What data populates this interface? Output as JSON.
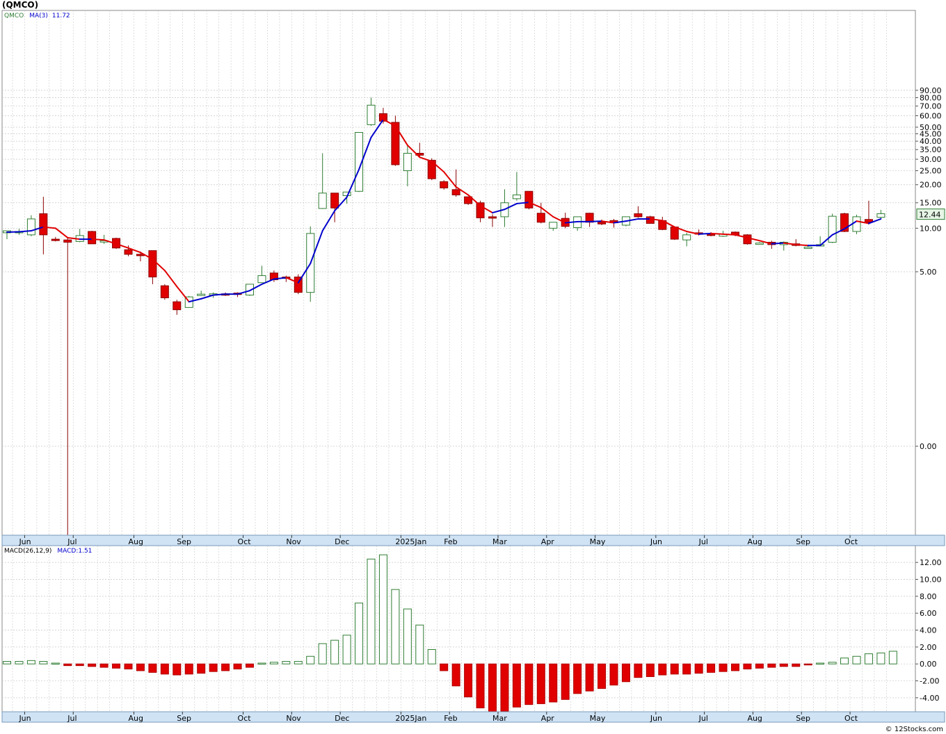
{
  "ticker_label": "(QMCO)",
  "credit": "© 12Stocks.com",
  "colors": {
    "up": "#2e7d32",
    "down": "#e00000",
    "ma_up": "#0000cc",
    "ma_down": "#e00000",
    "grid": "#c8c8c8",
    "axis_band": "#cfe3f5"
  },
  "chart_data": [
    {
      "type": "candlestick",
      "title": "",
      "legend": {
        "series_label": "QMCO",
        "ma_label": "MA(3)",
        "ma_value": "11.72"
      },
      "price_scale": "log",
      "y_ticks": [
        "90.00",
        "80.00",
        "70.00",
        "60.00",
        "50.00",
        "45.00",
        "40.00",
        "35.00",
        "30.00",
        "25.00",
        "20.00",
        "15.00",
        "10.00",
        "5.00",
        "0.00"
      ],
      "last_price": "12.44",
      "x_month_labels": [
        "Jun",
        "Jul",
        "Aug",
        "Sep",
        "Oct",
        "Nov",
        "Dec",
        "2025Jan",
        "Feb",
        "Mar",
        "Apr",
        "May",
        "Jun",
        "Jul",
        "Aug",
        "Sep",
        "Oct"
      ],
      "candles": [
        {
          "o": 9.3,
          "h": 9.6,
          "l": 8.4,
          "c": 9.6
        },
        {
          "o": 9.3,
          "h": 9.9,
          "l": 9.0,
          "c": 9.5
        },
        {
          "o": 9.0,
          "h": 12.3,
          "l": 8.8,
          "c": 11.6
        },
        {
          "o": 12.6,
          "h": 16.5,
          "l": 6.6,
          "c": 9.0
        },
        {
          "o": 8.4,
          "h": 8.7,
          "l": 8.1,
          "c": 8.3
        },
        {
          "o": 8.3,
          "h": 8.6,
          "l": 0.1,
          "c": 8.0
        },
        {
          "o": 8.1,
          "h": 9.9,
          "l": 8.0,
          "c": 8.9
        },
        {
          "o": 9.5,
          "h": 9.6,
          "l": 7.8,
          "c": 7.8
        },
        {
          "o": 8.1,
          "h": 9.0,
          "l": 7.8,
          "c": 8.2
        },
        {
          "o": 8.5,
          "h": 8.6,
          "l": 7.2,
          "c": 7.3
        },
        {
          "o": 7.1,
          "h": 7.6,
          "l": 6.4,
          "c": 6.6
        },
        {
          "o": 6.6,
          "h": 6.9,
          "l": 5.9,
          "c": 6.5
        },
        {
          "o": 7.0,
          "h": 7.0,
          "l": 4.1,
          "c": 4.6
        },
        {
          "o": 4.0,
          "h": 4.1,
          "l": 3.2,
          "c": 3.3
        },
        {
          "o": 3.1,
          "h": 3.2,
          "l": 2.52,
          "c": 2.73
        },
        {
          "o": 2.83,
          "h": 3.4,
          "l": 2.82,
          "c": 3.35
        },
        {
          "o": 3.47,
          "h": 3.7,
          "l": 3.4,
          "c": 3.5
        },
        {
          "o": 3.5,
          "h": 3.6,
          "l": 3.3,
          "c": 3.52
        },
        {
          "o": 3.52,
          "h": 3.6,
          "l": 3.4,
          "c": 3.5
        },
        {
          "o": 3.56,
          "h": 3.6,
          "l": 3.34,
          "c": 3.48
        },
        {
          "o": 3.45,
          "h": 4.1,
          "l": 3.4,
          "c": 4.1
        },
        {
          "o": 4.2,
          "h": 5.5,
          "l": 4.2,
          "c": 4.7
        },
        {
          "o": 4.9,
          "h": 5.1,
          "l": 4.25,
          "c": 4.4
        },
        {
          "o": 4.6,
          "h": 4.7,
          "l": 4.25,
          "c": 4.55
        },
        {
          "o": 4.6,
          "h": 4.8,
          "l": 3.5,
          "c": 3.6
        },
        {
          "o": 3.6,
          "h": 10.3,
          "l": 3.1,
          "c": 9.2
        },
        {
          "o": 13.7,
          "h": 33.0,
          "l": 13.6,
          "c": 17.5
        },
        {
          "o": 17.5,
          "h": 17.5,
          "l": 11.0,
          "c": 13.8
        },
        {
          "o": 16.8,
          "h": 17.7,
          "l": 14.8,
          "c": 17.8
        },
        {
          "o": 18.0,
          "h": 45.5,
          "l": 17.8,
          "c": 46.0
        },
        {
          "o": 52.0,
          "h": 80.0,
          "l": 51.0,
          "c": 71.0
        },
        {
          "o": 62.0,
          "h": 68.0,
          "l": 53.0,
          "c": 55.0
        },
        {
          "o": 54.0,
          "h": 60.0,
          "l": 27.0,
          "c": 27.5
        },
        {
          "o": 25.0,
          "h": 38.0,
          "l": 19.5,
          "c": 33.0
        },
        {
          "o": 33.0,
          "h": 39.0,
          "l": 31.0,
          "c": 32.0
        },
        {
          "o": 29.5,
          "h": 30.5,
          "l": 21.5,
          "c": 22.0
        },
        {
          "o": 21.0,
          "h": 21.5,
          "l": 18.5,
          "c": 19.0
        },
        {
          "o": 18.5,
          "h": 25.5,
          "l": 16.5,
          "c": 17.0
        },
        {
          "o": 16.5,
          "h": 16.5,
          "l": 14.5,
          "c": 14.8
        },
        {
          "o": 15.0,
          "h": 15.5,
          "l": 11.0,
          "c": 11.8
        },
        {
          "o": 12.0,
          "h": 12.5,
          "l": 10.2,
          "c": 11.8
        },
        {
          "o": 12.0,
          "h": 18.6,
          "l": 10.2,
          "c": 15.0
        },
        {
          "o": 16.0,
          "h": 24.5,
          "l": 15.5,
          "c": 17.0
        },
        {
          "o": 18.0,
          "h": 18.0,
          "l": 13.5,
          "c": 13.8
        },
        {
          "o": 12.7,
          "h": 15.0,
          "l": 10.8,
          "c": 11.0
        },
        {
          "o": 10.0,
          "h": 11.0,
          "l": 9.6,
          "c": 11.0
        },
        {
          "o": 11.7,
          "h": 12.8,
          "l": 10.0,
          "c": 10.3
        },
        {
          "o": 10.1,
          "h": 11.8,
          "l": 9.6,
          "c": 12.0
        },
        {
          "o": 12.7,
          "h": 12.8,
          "l": 10.2,
          "c": 11.0
        },
        {
          "o": 11.0,
          "h": 11.5,
          "l": 10.5,
          "c": 10.7
        },
        {
          "o": 11.3,
          "h": 11.6,
          "l": 10.1,
          "c": 10.9
        },
        {
          "o": 10.5,
          "h": 12.0,
          "l": 10.3,
          "c": 12.0
        },
        {
          "o": 12.6,
          "h": 14.2,
          "l": 11.8,
          "c": 12.0
        },
        {
          "o": 12.0,
          "h": 12.2,
          "l": 10.8,
          "c": 10.8
        },
        {
          "o": 11.3,
          "h": 12.0,
          "l": 9.7,
          "c": 9.8
        },
        {
          "o": 10.2,
          "h": 10.2,
          "l": 8.3,
          "c": 8.4
        },
        {
          "o": 8.3,
          "h": 9.3,
          "l": 7.5,
          "c": 9.0
        },
        {
          "o": 9.3,
          "h": 9.8,
          "l": 8.9,
          "c": 9.2
        },
        {
          "o": 9.1,
          "h": 9.4,
          "l": 8.8,
          "c": 8.9
        },
        {
          "o": 8.8,
          "h": 9.6,
          "l": 8.7,
          "c": 9.1
        },
        {
          "o": 9.4,
          "h": 9.5,
          "l": 8.8,
          "c": 9.0
        },
        {
          "o": 9.0,
          "h": 9.1,
          "l": 7.7,
          "c": 7.8
        },
        {
          "o": 7.8,
          "h": 8.0,
          "l": 7.7,
          "c": 7.9
        },
        {
          "o": 8.0,
          "h": 8.2,
          "l": 7.2,
          "c": 7.7
        },
        {
          "o": 7.7,
          "h": 8.1,
          "l": 7.0,
          "c": 8.0
        },
        {
          "o": 7.8,
          "h": 8.4,
          "l": 7.5,
          "c": 7.6
        },
        {
          "o": 7.3,
          "h": 7.6,
          "l": 7.2,
          "c": 7.4
        },
        {
          "o": 7.6,
          "h": 8.8,
          "l": 7.5,
          "c": 7.7
        },
        {
          "o": 8.0,
          "h": 12.6,
          "l": 7.9,
          "c": 12.1
        },
        {
          "o": 12.6,
          "h": 12.8,
          "l": 9.4,
          "c": 9.5
        },
        {
          "o": 9.5,
          "h": 12.4,
          "l": 9.1,
          "c": 12.0
        },
        {
          "o": 11.5,
          "h": 15.5,
          "l": 10.6,
          "c": 11.0
        },
        {
          "o": 11.9,
          "h": 13.4,
          "l": 11.5,
          "c": 12.6
        }
      ],
      "ma3": [
        9.4,
        9.45,
        9.6,
        10.2,
        10.0,
        8.6,
        8.4,
        8.4,
        8.3,
        7.8,
        7.3,
        6.8,
        6.1,
        5.1,
        3.95,
        3.1,
        3.25,
        3.45,
        3.5,
        3.5,
        3.7,
        4.1,
        4.45,
        4.55,
        4.2,
        5.7,
        9.6,
        13.2,
        16.4,
        25.5,
        42.5,
        56.5,
        51.0,
        37.5,
        31.0,
        29.0,
        24.5,
        19.3,
        17.0,
        14.3,
        12.8,
        13.5,
        14.8,
        15.1,
        13.9,
        12.0,
        10.9,
        11.1,
        11.1,
        11.2,
        10.9,
        11.2,
        11.6,
        11.6,
        11.3,
        10.2,
        9.5,
        9.1,
        9.2,
        9.1,
        9.0,
        8.6,
        8.2,
        7.8,
        7.9,
        7.7,
        7.6,
        7.6,
        9.0,
        9.9,
        11.2,
        10.8,
        11.6
      ]
    },
    {
      "type": "bar",
      "title": "",
      "legend": {
        "series_label": "MACD(26,12,9)",
        "value_label": "MACD:1.51"
      },
      "y_ticks": [
        "12.00",
        "10.00",
        "8.00",
        "6.00",
        "4.00",
        "2.00",
        "0.00",
        "-2.00",
        "-4.00"
      ],
      "ylim": [
        -5.8,
        13.3
      ],
      "x_month_labels": [
        "Jun",
        "Jul",
        "Aug",
        "Sep",
        "Oct",
        "Nov",
        "Dec",
        "2025Jan",
        "Feb",
        "Mar",
        "Apr",
        "May",
        "Jun",
        "Jul",
        "Aug",
        "Sep",
        "Oct"
      ],
      "values": [
        0.3,
        0.3,
        0.4,
        0.3,
        0.1,
        -0.2,
        -0.2,
        -0.3,
        -0.4,
        -0.5,
        -0.6,
        -0.8,
        -1.0,
        -1.2,
        -1.3,
        -1.2,
        -1.1,
        -0.9,
        -0.8,
        -0.6,
        -0.4,
        0.1,
        0.2,
        0.3,
        0.3,
        0.9,
        2.4,
        2.8,
        3.4,
        7.2,
        12.4,
        12.9,
        8.8,
        6.5,
        4.6,
        1.7,
        -0.8,
        -2.6,
        -3.9,
        -5.2,
        -5.8,
        -5.6,
        -5.1,
        -4.8,
        -4.7,
        -4.5,
        -4.2,
        -3.5,
        -3.2,
        -2.9,
        -2.5,
        -2.1,
        -1.6,
        -1.5,
        -1.3,
        -1.2,
        -1.2,
        -1.1,
        -1.0,
        -0.9,
        -0.8,
        -0.6,
        -0.5,
        -0.4,
        -0.3,
        -0.3,
        -0.1,
        0.1,
        0.2,
        0.7,
        0.9,
        1.2,
        1.3,
        1.5
      ]
    }
  ]
}
